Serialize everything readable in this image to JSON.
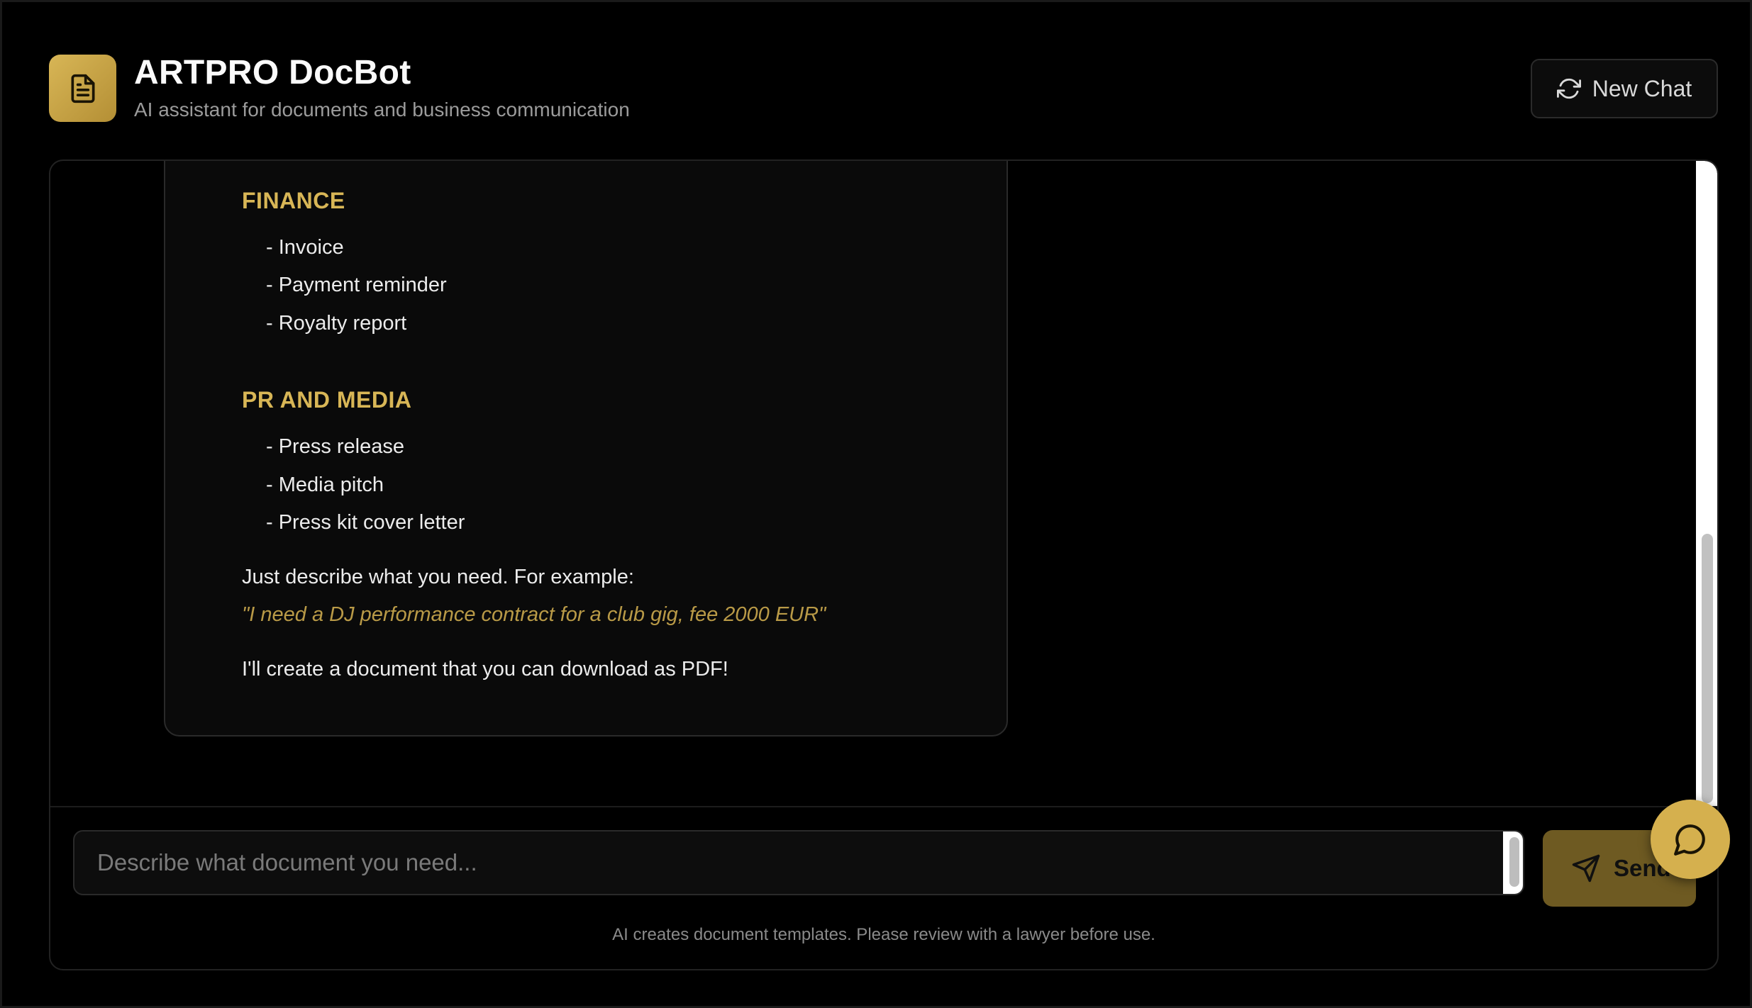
{
  "header": {
    "title": "ARTPRO DocBot",
    "subtitle": "AI assistant for documents and business communication",
    "logo_icon": "document-icon",
    "new_chat_label": "New Chat",
    "new_chat_icon": "refresh-icon"
  },
  "message": {
    "sections": [
      {
        "title": "FINANCE",
        "items": [
          "- Invoice",
          "- Payment reminder",
          "- Royalty report"
        ]
      },
      {
        "title": "PR AND MEDIA",
        "items": [
          "- Press release",
          "- Media pitch",
          "- Press kit cover letter"
        ]
      }
    ],
    "intro": "Just describe what you need. For example:",
    "example": "\"I need a DJ performance contract for a club gig, fee 2000 EUR\"",
    "closing": "I'll create a document that you can download as PDF!"
  },
  "composer": {
    "placeholder": "Describe what document you need...",
    "value": "",
    "send_label": "Send",
    "send_icon": "send-icon",
    "disclaimer": "AI creates document templates. Please review with a lawyer before use."
  },
  "widget": {
    "icon": "chat-bubble-icon"
  },
  "colors": {
    "accent": "#d8b656",
    "background": "#000000",
    "panel_border": "#222222",
    "send_button": "#6e5a22"
  }
}
